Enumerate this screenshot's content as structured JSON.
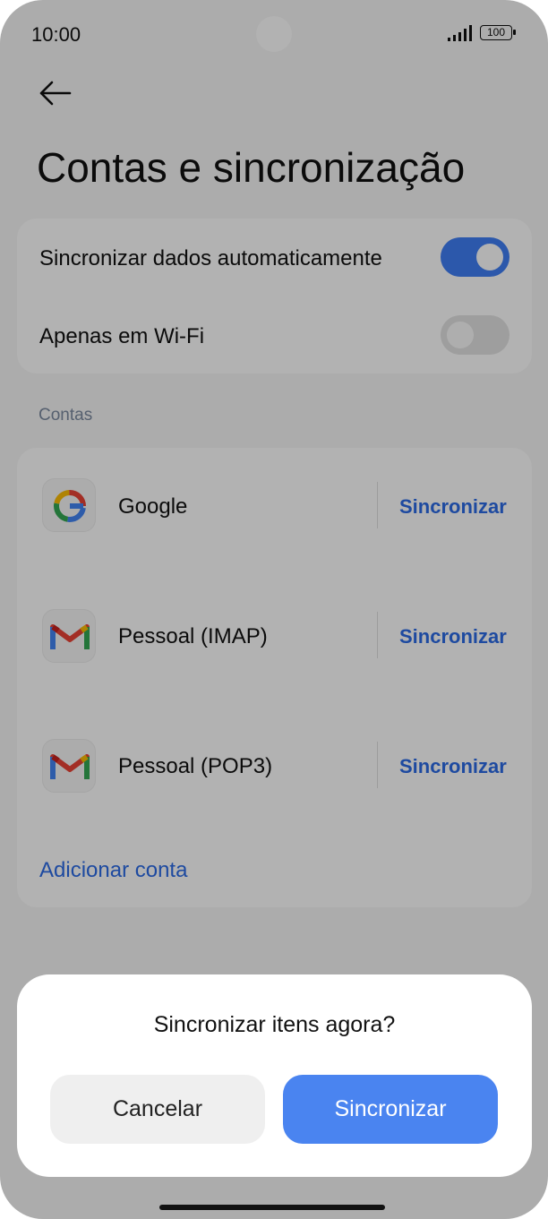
{
  "status_bar": {
    "time": "10:00",
    "battery": "100"
  },
  "page": {
    "title": "Contas e sincronização"
  },
  "settings": [
    {
      "label": "Sincronizar dados automaticamente",
      "enabled": true
    },
    {
      "label": "Apenas em Wi-Fi",
      "enabled": false
    }
  ],
  "accounts_section": {
    "label": "Contas"
  },
  "accounts": [
    {
      "name": "Google",
      "icon": "google-icon",
      "action": "Sincronizar"
    },
    {
      "name": "Pessoal (IMAP)",
      "icon": "gmail-icon",
      "action": "Sincronizar"
    },
    {
      "name": "Pessoal (POP3)",
      "icon": "gmail-icon",
      "action": "Sincronizar"
    }
  ],
  "add_account_label": "Adicionar conta",
  "dialog": {
    "title": "Sincronizar itens agora?",
    "cancel": "Cancelar",
    "confirm": "Sincronizar"
  },
  "colors": {
    "accent": "#3f7ff5",
    "link": "#2b6be6"
  }
}
